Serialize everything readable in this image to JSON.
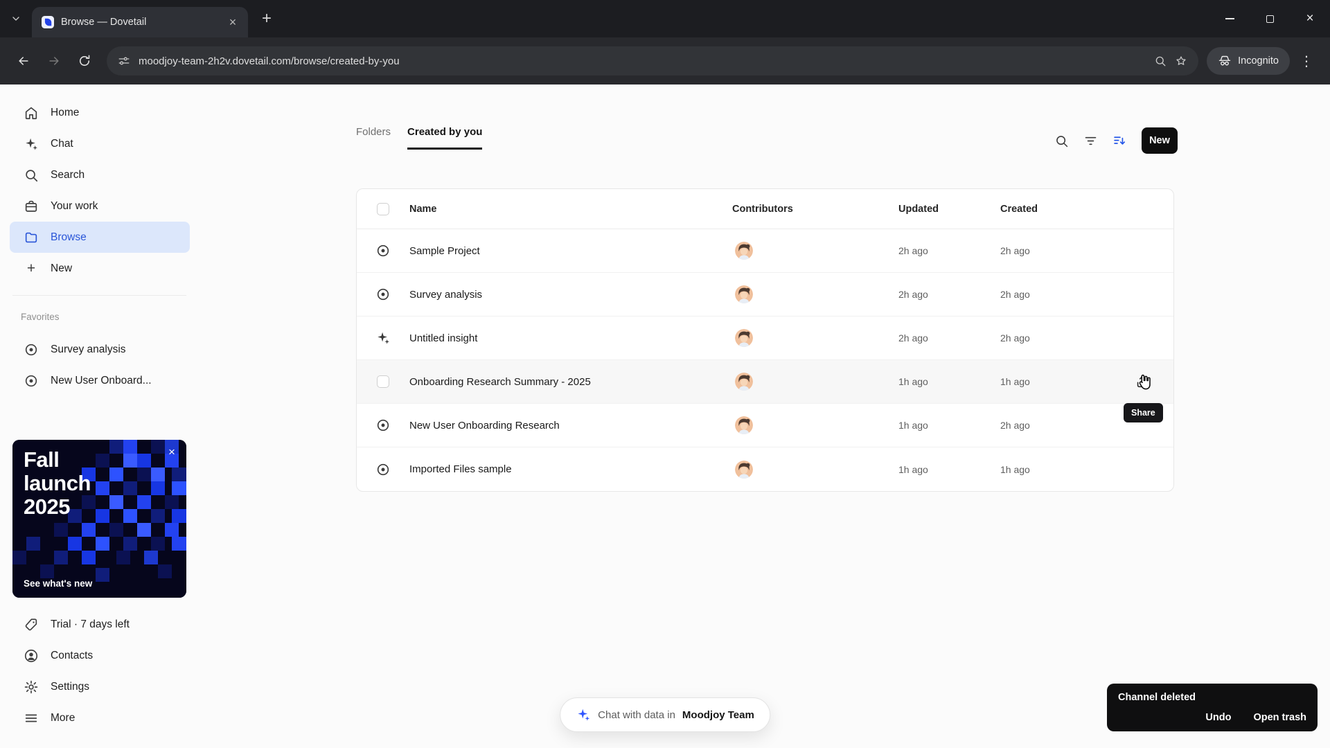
{
  "theme": {
    "accent_blue": "#2a56d8",
    "sort_icon_blue": "#2456e8",
    "sidebar_active_bg": "#dce7fb",
    "new_button_bg": "#0e0e0e",
    "toast_bg": "#0f0f10",
    "promo_bg": "#06061c"
  },
  "browser": {
    "tab_title": "Browse — Dovetail",
    "url": "moodjoy-team-2h2v.dovetail.com/browse/created-by-you",
    "incognito_label": "Incognito"
  },
  "icons": {
    "close_glyph": "×",
    "plus_glyph": "+",
    "menu_glyph": "⋮",
    "promo_close_glyph": "×"
  },
  "sidebar": {
    "items": [
      {
        "label": "Home",
        "icon": "home-icon"
      },
      {
        "label": "Chat",
        "icon": "sparkle-icon"
      },
      {
        "label": "Search",
        "icon": "search-icon"
      },
      {
        "label": "Your work",
        "icon": "briefcase-icon"
      },
      {
        "label": "Browse",
        "icon": "folder-icon",
        "active": true
      },
      {
        "label": "New",
        "icon": "plus-icon"
      }
    ],
    "favorites_label": "Favorites",
    "favorites": [
      {
        "label": "Survey analysis",
        "icon": "target-icon"
      },
      {
        "label": "New User Onboard...",
        "icon": "target-icon"
      }
    ],
    "promo": {
      "title": "Fall launch 2025",
      "link": "See what's new"
    },
    "footer": [
      {
        "label": "Trial · 7 days left",
        "icon": "tag-icon"
      },
      {
        "label": "Contacts",
        "icon": "person-icon"
      },
      {
        "label": "Settings",
        "icon": "gear-icon"
      },
      {
        "label": "More",
        "icon": "hamburger-icon"
      }
    ]
  },
  "main": {
    "tabs": [
      {
        "label": "Folders"
      },
      {
        "label": "Created by you",
        "active": true
      }
    ],
    "new_label": "New",
    "table": {
      "columns": {
        "name": "Name",
        "contributors": "Contributors",
        "updated": "Updated",
        "created": "Created"
      },
      "rows": [
        {
          "name": "Sample Project",
          "icon": "target-icon",
          "updated": "2h ago",
          "created": "2h ago"
        },
        {
          "name": "Survey analysis",
          "icon": "target-icon",
          "updated": "2h ago",
          "created": "2h ago"
        },
        {
          "name": "Untitled insight",
          "icon": "sparkle-icon",
          "updated": "2h ago",
          "created": "2h ago"
        },
        {
          "name": "Onboarding Research Summary - 2025",
          "icon": "checkbox",
          "updated": "1h ago",
          "created": "1h ago",
          "hovered": true
        },
        {
          "name": "New User Onboarding Research",
          "icon": "target-icon",
          "updated": "1h ago",
          "created": "2h ago"
        },
        {
          "name": "Imported Files sample",
          "icon": "target-icon",
          "updated": "1h ago",
          "created": "1h ago"
        }
      ]
    },
    "share_tooltip": "Share"
  },
  "chat_pill": {
    "prefix": "Chat with data in",
    "team": "Moodjoy Team"
  },
  "toast": {
    "title": "Channel deleted",
    "undo_label": "Undo",
    "open_trash_label": "Open trash"
  }
}
